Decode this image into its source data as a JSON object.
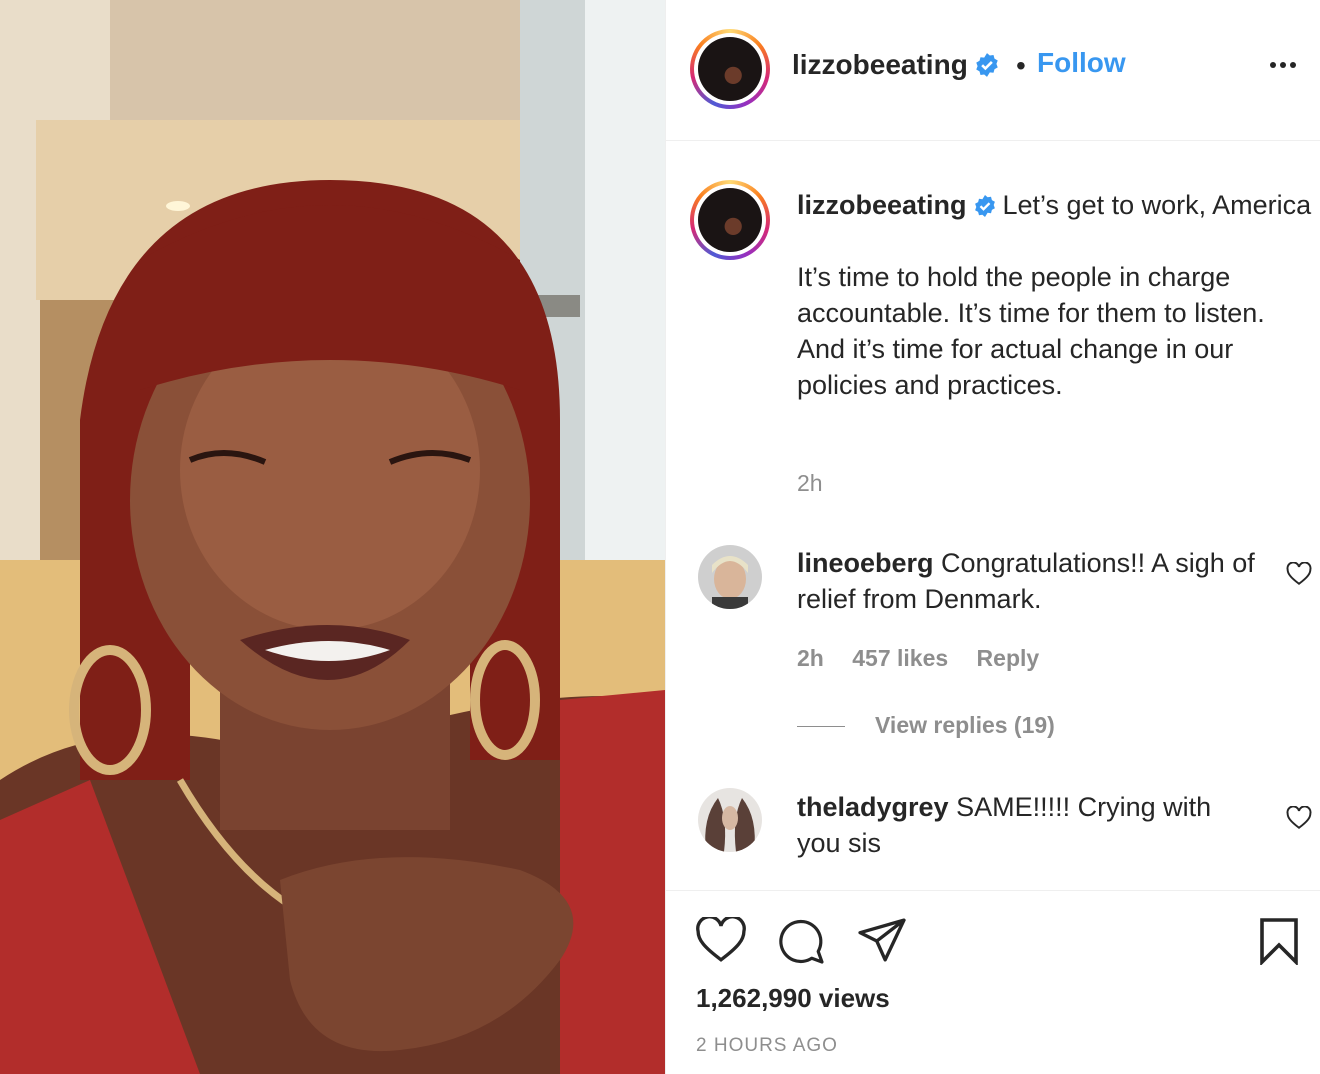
{
  "post": {
    "author": "lizzobeeating",
    "dot": "•",
    "follow_label": "Follow",
    "caption_title": "Let’s get to work, America",
    "caption_body": "It’s time to hold the people in charge accountable. It’s time for them to listen. And it’s time for actual change in our policies and practices.",
    "caption_time": "2h"
  },
  "comments": [
    {
      "username": "lineoeberg",
      "text": "Congratulations!! A sigh of relief from Denmark.",
      "time": "2h",
      "likes": "457 likes",
      "reply": "Reply",
      "view_replies": "View replies (19)"
    },
    {
      "username": "theladygrey",
      "text": "SAME!!!!! Crying with you sis"
    }
  ],
  "footer": {
    "views": "1,262,990 views",
    "posted": "2 HOURS AGO"
  },
  "colors": {
    "link": "#3897f0",
    "verified": "#3897f0",
    "muted": "#8e8e8e",
    "text": "#262626"
  },
  "icons": [
    "verified-badge-icon",
    "more-options-icon",
    "heart-icon",
    "comment-icon",
    "share-icon",
    "bookmark-icon"
  ]
}
